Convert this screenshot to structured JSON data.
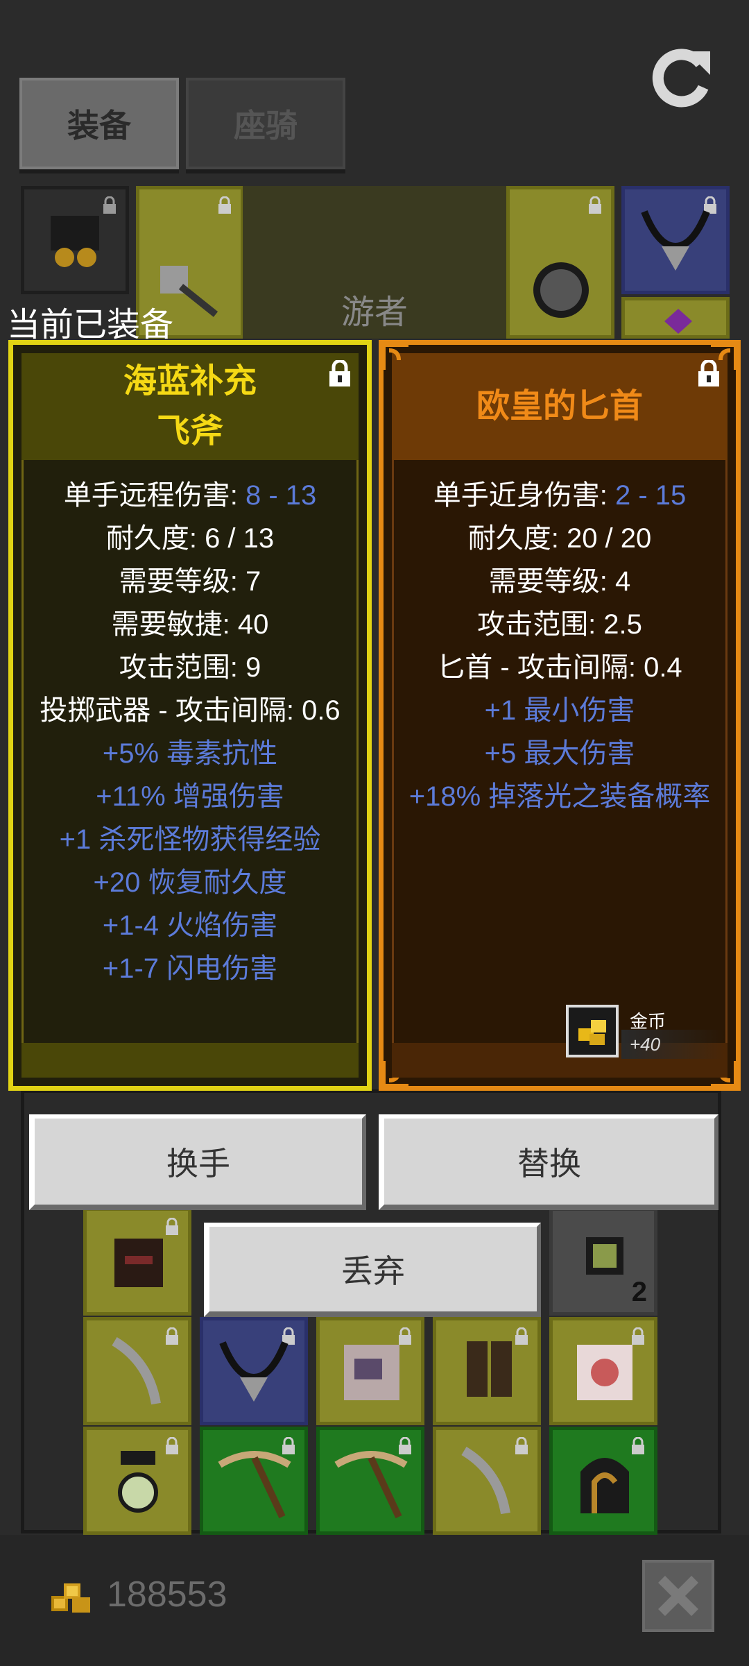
{
  "tabs": {
    "equip_label": "装备",
    "mount_label": "座骑"
  },
  "hero": {
    "name": "游者"
  },
  "equipped_heading": "当前已装备",
  "left_card": {
    "title_line1": "海蓝补充",
    "title_line2": "飞斧",
    "stats": [
      {
        "label": "单手远程伤害: ",
        "value": "8 - 13"
      },
      {
        "text": "耐久度: 6 / 13"
      },
      {
        "text": "需要等级: 7"
      },
      {
        "text": "需要敏捷: 40"
      },
      {
        "text": "攻击范围: 9"
      },
      {
        "text": "投掷武器 - 攻击间隔: 0.6"
      }
    ],
    "bonuses": [
      "+5% 毒素抗性",
      "+11% 增强伤害",
      "+1 杀死怪物获得经验",
      "+20 恢复耐久度",
      "+1-4 火焰伤害",
      "+1-7 闪电伤害"
    ]
  },
  "right_card": {
    "title": "欧皇的匕首",
    "stats": [
      {
        "label": "单手近身伤害: ",
        "value": "2 - 15"
      },
      {
        "text": "耐久度: 20 / 20"
      },
      {
        "text": "需要等级: 4"
      },
      {
        "text": "攻击范围: 2.5"
      },
      {
        "text": "匕首 - 攻击间隔: 0.4"
      }
    ],
    "bonuses": [
      "+1 最小伤害",
      "+5 最大伤害",
      "+18% 掉落光之装备概率"
    ],
    "gold_bonus": {
      "label": "金币",
      "value": "+40"
    }
  },
  "buttons": {
    "swap_hand": "换手",
    "replace": "替换",
    "discard": "丢弃"
  },
  "inventory": {
    "stack_count": "2"
  },
  "footer": {
    "gold_amount": "188553"
  },
  "colors": {
    "left_rarity": "#e2d414",
    "right_rarity": "#e68a14",
    "bonus_text": "#5c7bd9"
  }
}
